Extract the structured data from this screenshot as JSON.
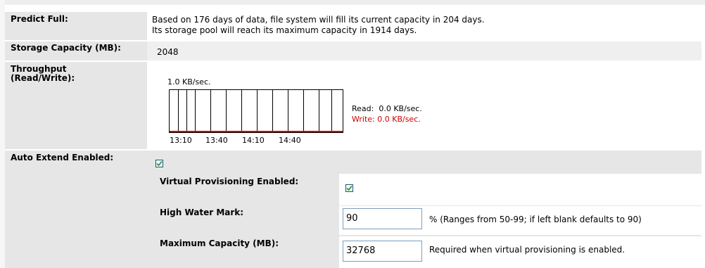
{
  "predict_full": {
    "label": "Predict Full:",
    "line1": "Based on 176 days of data, file system will fill its current capacity in 204 days.",
    "line2": "Its storage pool will reach its maximum capacity in 1914 days."
  },
  "storage_capacity": {
    "label": "Storage Capacity (MB):",
    "value": "2048"
  },
  "throughput": {
    "label_line1": "Throughput",
    "label_line2": "(Read/Write):",
    "scale": "1.0 KB/sec.",
    "x_ticks": [
      "13:10",
      "13:40",
      "14:10",
      "14:40"
    ],
    "read": "Read:  0.0 KB/sec.",
    "write": "Write: 0.0 KB/sec.",
    "write_color": "#cc0000"
  },
  "auto_extend": {
    "label": "Auto Extend Enabled:",
    "checked": true,
    "virtual_provisioning": {
      "label": "Virtual Provisioning Enabled:",
      "checked": true
    },
    "high_water_mark": {
      "label": "High Water Mark:",
      "value": "90",
      "hint": "% (Ranges from 50-99; if left blank defaults to 90)"
    },
    "maximum_capacity": {
      "label": "Maximum Capacity (MB):",
      "value": "32768",
      "hint": "Required when virtual provisioning is enabled."
    }
  }
}
